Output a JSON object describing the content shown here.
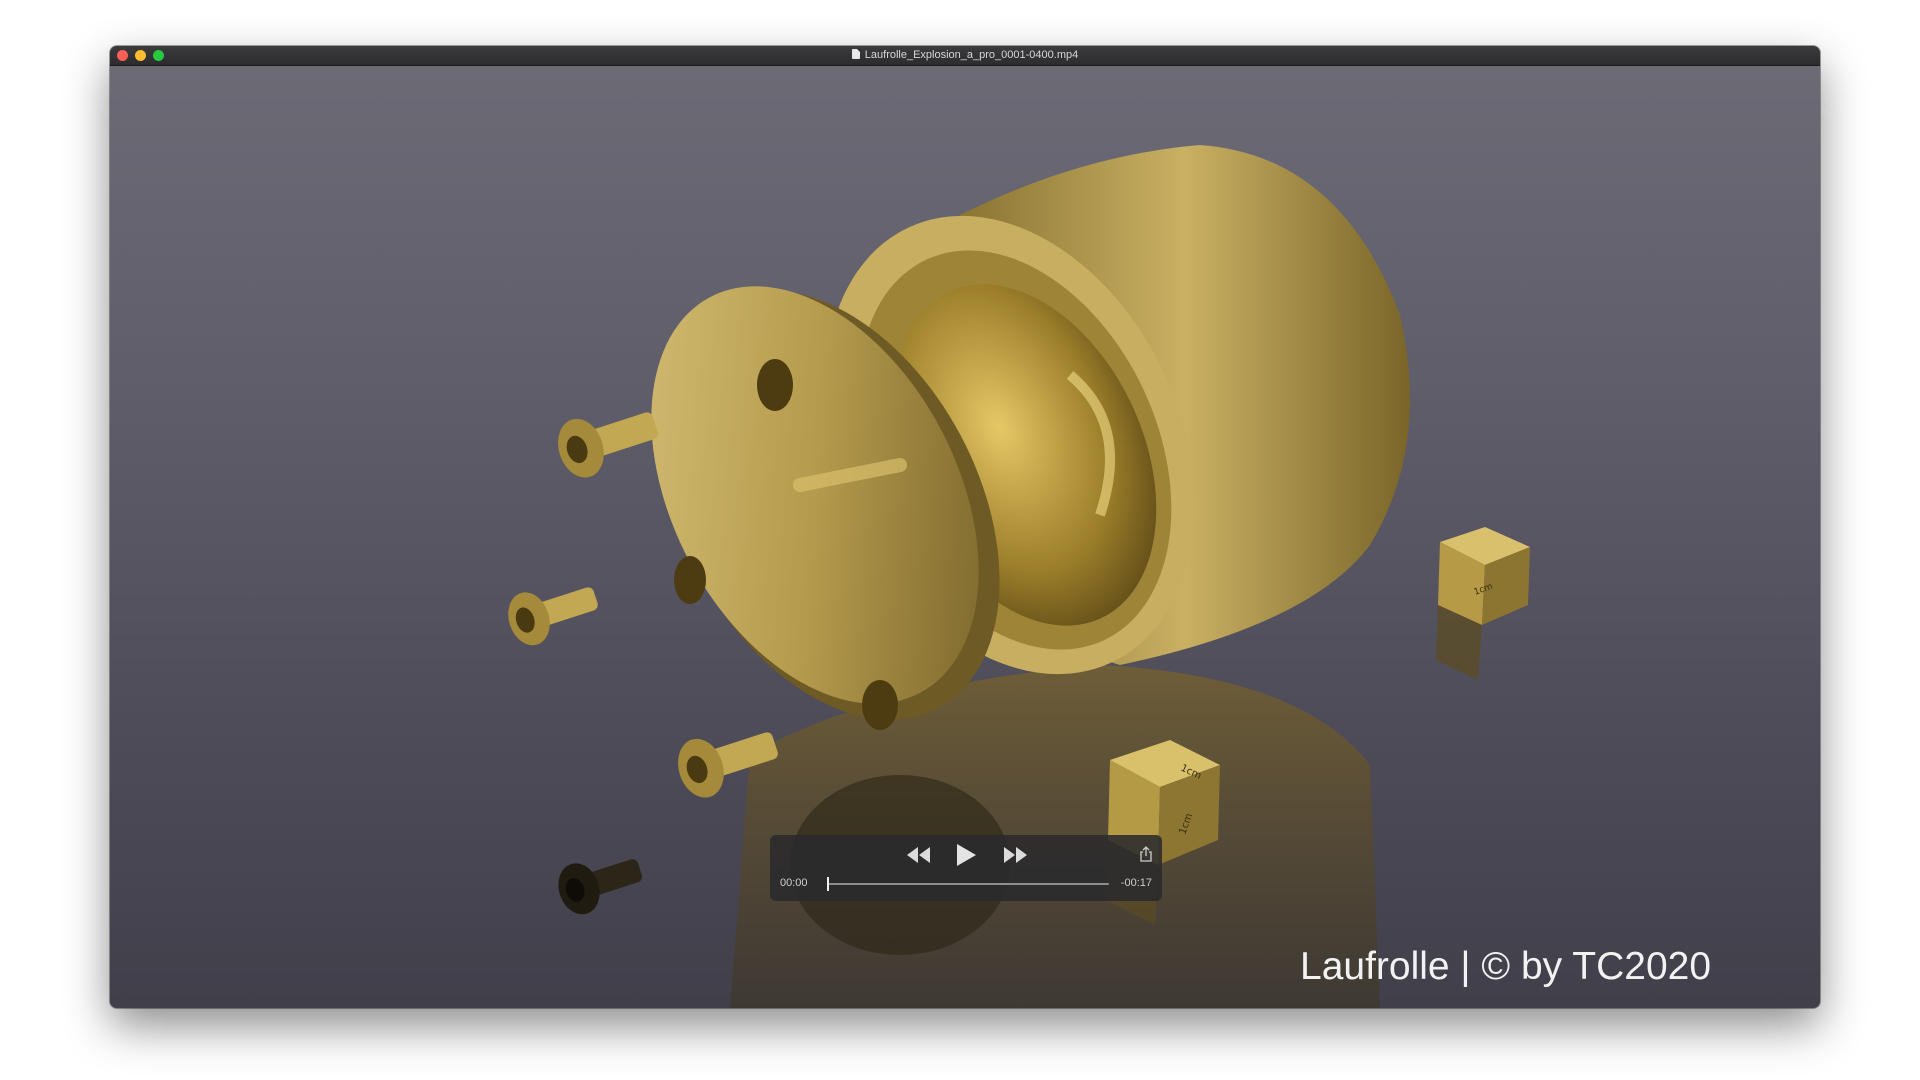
{
  "window": {
    "title": "Laufrolle_Explosion_a_pro_0001-0400.mp4",
    "colors": {
      "close": "#fe5f57",
      "minimize": "#febc2e",
      "maximize": "#28c840"
    }
  },
  "player": {
    "elapsed": "00:00",
    "remaining": "-00:17",
    "progress": 0,
    "icons": {
      "rewind": "rewind-icon",
      "play": "play-icon",
      "fast_forward": "fast-forward-icon",
      "share": "share-icon"
    }
  },
  "video": {
    "watermark": "Laufrolle | © by TC2020",
    "cube_labels": [
      "1cm",
      "1cm",
      "1cm"
    ]
  }
}
